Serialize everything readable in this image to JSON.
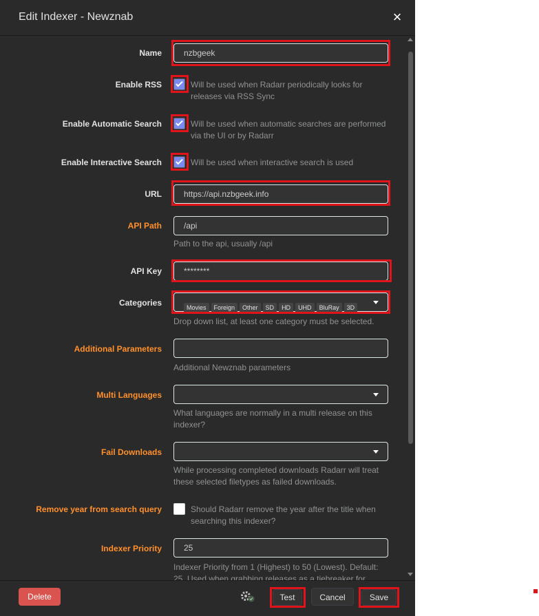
{
  "modal": {
    "title": "Edit Indexer - Newznab",
    "close_symbol": "×"
  },
  "fields": {
    "name": {
      "label": "Name",
      "value": "nzbgeek"
    },
    "enable_rss": {
      "label": "Enable RSS",
      "checked": true,
      "help": "Will be used when Radarr periodically looks for releases via RSS Sync"
    },
    "enable_automatic_search": {
      "label": "Enable Automatic Search",
      "checked": true,
      "help": "Will be used when automatic searches are performed via the UI or by Radarr"
    },
    "enable_interactive_search": {
      "label": "Enable Interactive Search",
      "checked": true,
      "help": "Will be used when interactive search is used"
    },
    "url": {
      "label": "URL",
      "value": "https://api.nzbgeek.info"
    },
    "api_path": {
      "label": "API Path",
      "value": "/api",
      "help": "Path to the api, usually /api"
    },
    "api_key": {
      "label": "API Key",
      "value": "********"
    },
    "categories": {
      "label": "Categories",
      "tags": [
        "Movies",
        "Foreign",
        "Other",
        "SD",
        "HD",
        "UHD",
        "BluRay",
        "3D"
      ],
      "help": "Drop down list, at least one category must be selected."
    },
    "additional_parameters": {
      "label": "Additional Parameters",
      "value": "",
      "help": "Additional Newznab parameters"
    },
    "multi_languages": {
      "label": "Multi Languages",
      "help": "What languages are normally in a multi release on this indexer?"
    },
    "fail_downloads": {
      "label": "Fail Downloads",
      "help": "While processing completed downloads Radarr will treat these selected filetypes as failed downloads."
    },
    "remove_year": {
      "label": "Remove year from search query",
      "checked": false,
      "help": "Should Radarr remove the year after the title when searching this indexer?"
    },
    "indexer_priority": {
      "label": "Indexer Priority",
      "value": "25",
      "help": "Indexer Priority from 1 (Highest) to 50 (Lowest). Default: 25. Used when grabbing releases as a tiebreaker for otherwise"
    }
  },
  "footer": {
    "delete_label": "Delete",
    "test_label": "Test",
    "cancel_label": "Cancel",
    "save_label": "Save"
  },
  "colors": {
    "highlight": "#e0141b",
    "advanced_label": "#ff902b",
    "delete_button": "#d9534f",
    "checkbox_checked": "#7a8bf0"
  }
}
